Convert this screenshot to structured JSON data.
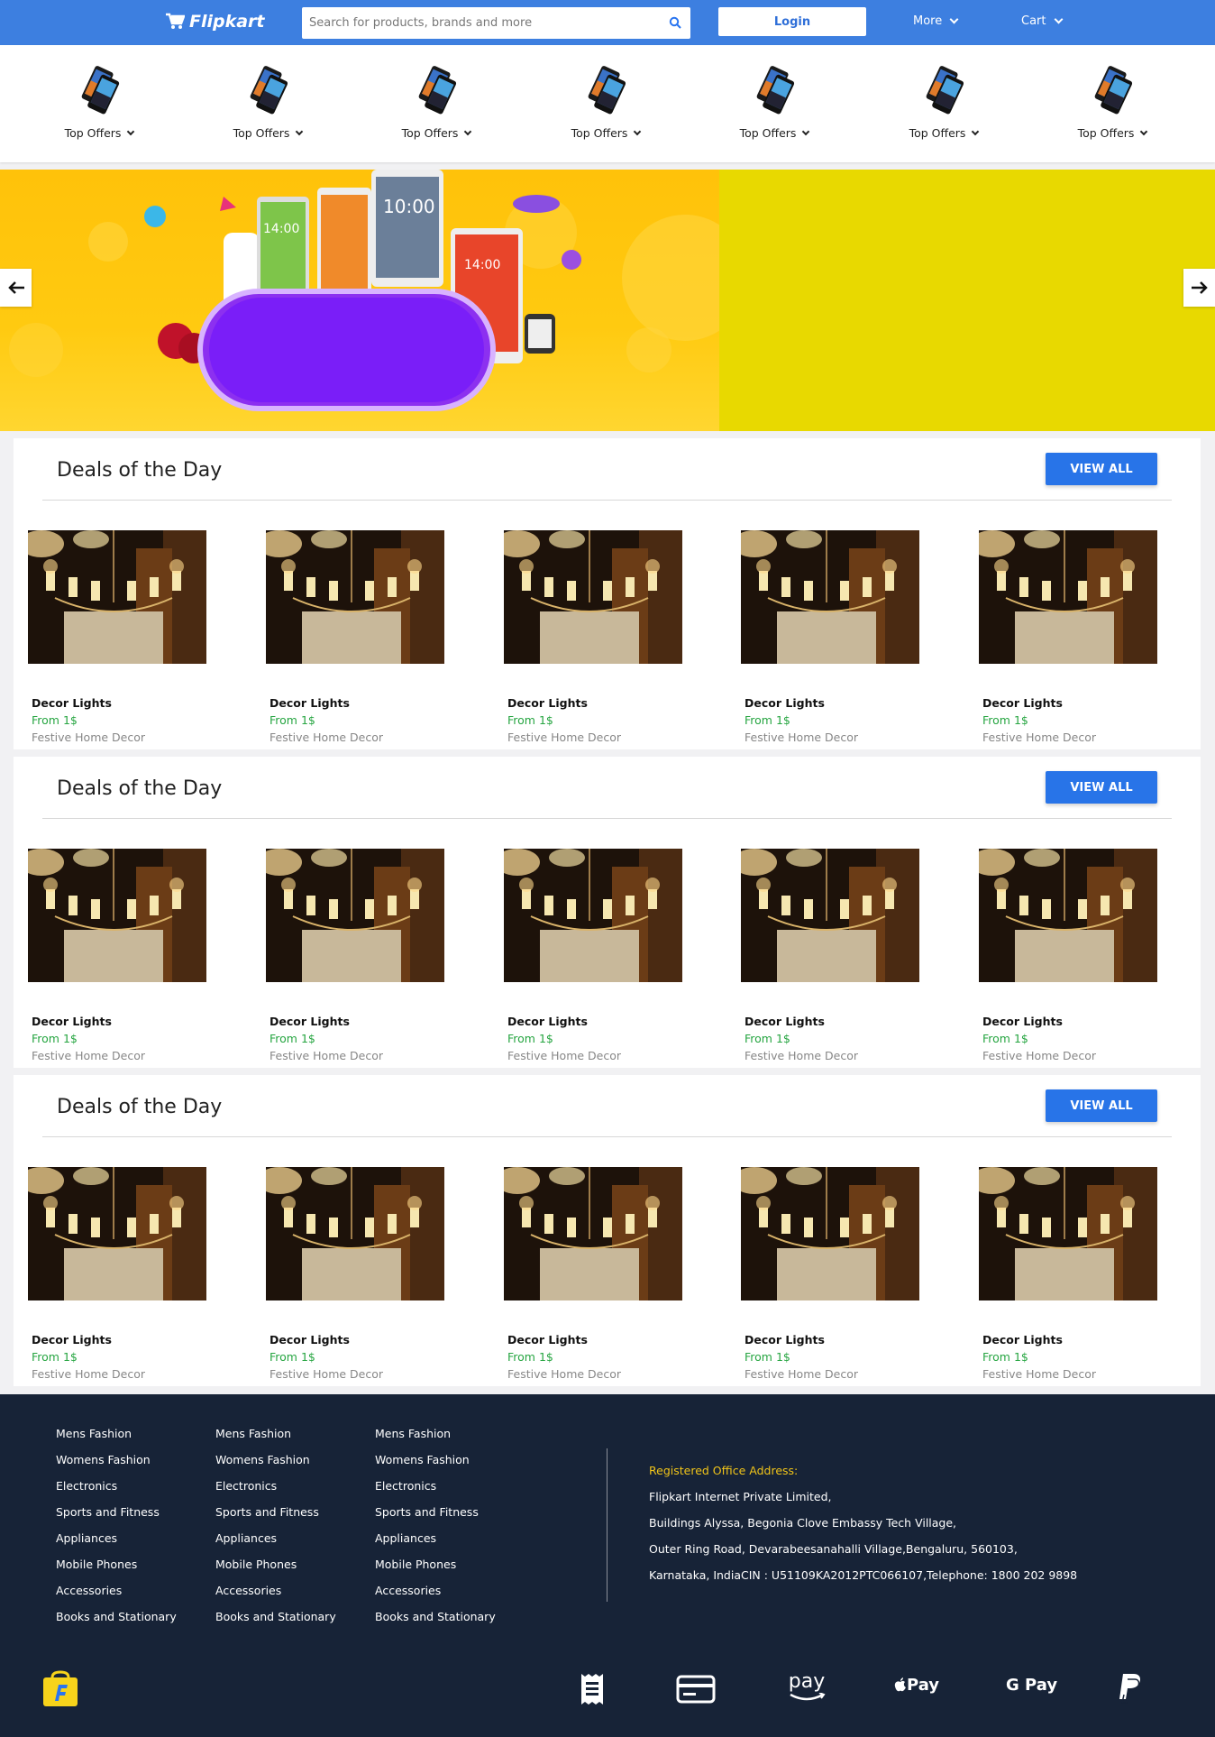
{
  "header": {
    "logo_text": "Flipkart",
    "search_placeholder": "Search for products, brands and more",
    "login_label": "Login",
    "more_label": "More",
    "cart_label": "Cart",
    "brand_color": "#3d7fe0"
  },
  "categories": [
    {
      "label": "Top Offers",
      "icon": "phone-icon"
    },
    {
      "label": "Top Offers",
      "icon": "phone-icon"
    },
    {
      "label": "Top Offers",
      "icon": "phone-icon"
    },
    {
      "label": "Top Offers",
      "icon": "phone-icon"
    },
    {
      "label": "Top Offers",
      "icon": "phone-icon"
    },
    {
      "label": "Top Offers",
      "icon": "phone-icon"
    },
    {
      "label": "Top Offers",
      "icon": "phone-icon"
    }
  ],
  "banner": {
    "prev_icon": "arrow-left-icon",
    "next_icon": "arrow-right-icon",
    "phone_times": [
      "14:00",
      "10:00",
      "14:00"
    ]
  },
  "sections": [
    {
      "title": "Deals of the Day",
      "view_all_label": "VIEW ALL",
      "products": [
        {
          "name": "Decor Lights",
          "price": "From 1$",
          "category": "Festive Home Decor"
        },
        {
          "name": "Decor Lights",
          "price": "From 1$",
          "category": "Festive Home Decor"
        },
        {
          "name": "Decor Lights",
          "price": "From 1$",
          "category": "Festive Home Decor"
        },
        {
          "name": "Decor Lights",
          "price": "From 1$",
          "category": "Festive Home Decor"
        },
        {
          "name": "Decor Lights",
          "price": "From 1$",
          "category": "Festive Home Decor"
        }
      ]
    },
    {
      "title": "Deals of the Day",
      "view_all_label": "VIEW ALL",
      "products": [
        {
          "name": "Decor Lights",
          "price": "From 1$",
          "category": "Festive Home Decor"
        },
        {
          "name": "Decor Lights",
          "price": "From 1$",
          "category": "Festive Home Decor"
        },
        {
          "name": "Decor Lights",
          "price": "From 1$",
          "category": "Festive Home Decor"
        },
        {
          "name": "Decor Lights",
          "price": "From 1$",
          "category": "Festive Home Decor"
        },
        {
          "name": "Decor Lights",
          "price": "From 1$",
          "category": "Festive Home Decor"
        }
      ]
    },
    {
      "title": "Deals of the Day",
      "view_all_label": "VIEW ALL",
      "products": [
        {
          "name": "Decor Lights",
          "price": "From 1$",
          "category": "Festive Home Decor"
        },
        {
          "name": "Decor Lights",
          "price": "From 1$",
          "category": "Festive Home Decor"
        },
        {
          "name": "Decor Lights",
          "price": "From 1$",
          "category": "Festive Home Decor"
        },
        {
          "name": "Decor Lights",
          "price": "From 1$",
          "category": "Festive Home Decor"
        },
        {
          "name": "Decor Lights",
          "price": "From 1$",
          "category": "Festive Home Decor"
        }
      ]
    }
  ],
  "footer": {
    "columns": [
      [
        "Mens Fashion",
        "Womens Fashion",
        "Electronics",
        "Sports and Fitness",
        "Appliances",
        "Mobile Phones",
        "Accessories",
        "Books and Stationary"
      ],
      [
        "Mens Fashion",
        "Womens Fashion",
        "Electronics",
        "Sports and Fitness",
        "Appliances",
        "Mobile Phones",
        "Accessories",
        "Books and Stationary"
      ],
      [
        "Mens Fashion",
        "Womens Fashion",
        "Electronics",
        "Sports and Fitness",
        "Appliances",
        "Mobile Phones",
        "Accessories",
        "Books and Stationary"
      ]
    ],
    "address_heading": "Registered Office Address:",
    "address_lines": [
      "Flipkart Internet Private Limited,",
      "Buildings Alyssa, Begonia Clove Embassy Tech Village,",
      "Outer Ring Road, Devarabeesanahalli Village,Bengaluru, 560103,",
      "Karnataka, IndiaCIN : U51109KA2012PTC066107,Telephone: 1800 202 9898"
    ],
    "payment_labels": {
      "amazon": "pay",
      "apple": "Pay",
      "google": "G Pay"
    },
    "payment_icons": [
      "receipt-icon",
      "card-icon",
      "amazon-pay-icon",
      "apple-pay-icon",
      "google-pay-icon",
      "paypal-icon"
    ],
    "heading_color": "#f0c419"
  }
}
